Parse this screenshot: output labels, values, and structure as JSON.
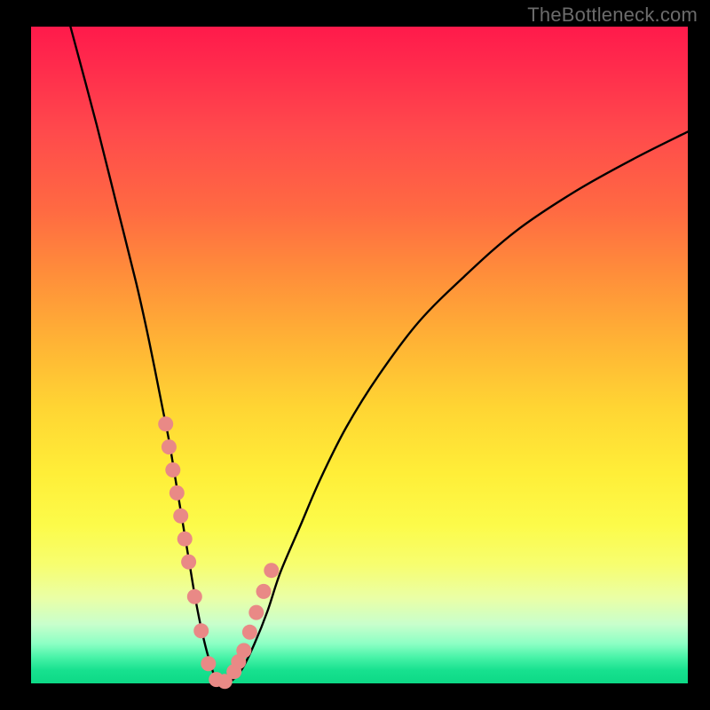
{
  "watermark": "TheBottleneck.com",
  "chart_data": {
    "type": "line",
    "title": "",
    "xlabel": "",
    "ylabel": "",
    "xlim": [
      0,
      100
    ],
    "ylim": [
      0,
      100
    ],
    "series": [
      {
        "name": "curve",
        "x": [
          6,
          10,
          13,
          16,
          18,
          20,
          21,
          22,
          23,
          24,
          25,
          26,
          27,
          28,
          29,
          30,
          32,
          34,
          36,
          38,
          41,
          44,
          48,
          53,
          59,
          66,
          74,
          83,
          92,
          100
        ],
        "values": [
          100,
          85,
          73,
          61,
          52,
          42,
          37,
          31,
          25,
          19,
          13,
          8,
          4,
          1,
          0,
          0,
          2,
          6,
          11,
          17,
          24,
          31,
          39,
          47,
          55,
          62,
          69,
          75,
          80,
          84
        ]
      }
    ],
    "markers": {
      "name": "highlighted-points",
      "color": "#e98986",
      "x": [
        20.5,
        21.0,
        21.6,
        22.2,
        22.8,
        23.4,
        24.0,
        24.9,
        25.9,
        27.0,
        28.2,
        29.5,
        30.9,
        31.6,
        32.4,
        33.3,
        34.3,
        35.4,
        36.6
      ],
      "values": [
        39.5,
        36.0,
        32.5,
        29.0,
        25.5,
        22.0,
        18.5,
        13.2,
        8.0,
        3.0,
        0.6,
        0.3,
        1.8,
        3.3,
        5.0,
        7.8,
        10.8,
        14.0,
        17.2
      ]
    }
  }
}
